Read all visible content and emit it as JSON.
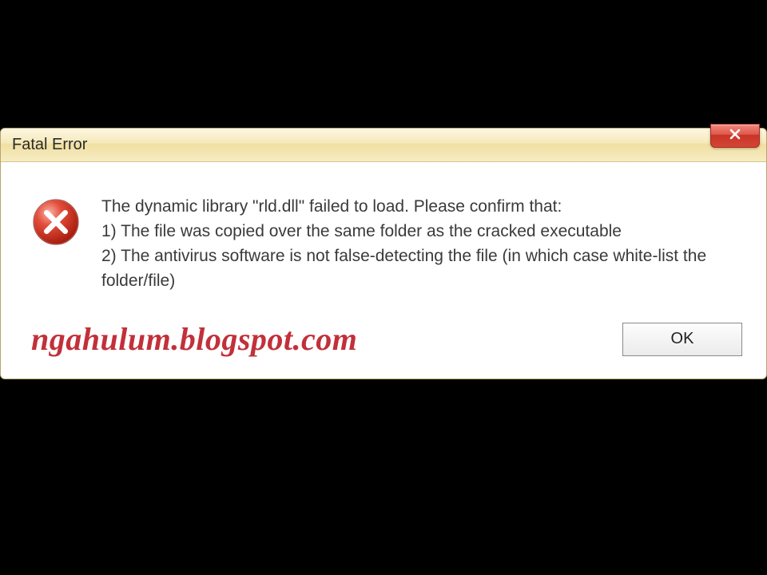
{
  "dialog": {
    "title": "Fatal Error",
    "message": "The dynamic library \"rld.dll\" failed to load. Please confirm that:\n1) The file was copied over the same folder as the cracked executable\n2) The antivirus software is not false-detecting the file (in which case white-list the folder/file)",
    "ok_label": "OK"
  },
  "watermark": "ngahulum.blogspot.com"
}
